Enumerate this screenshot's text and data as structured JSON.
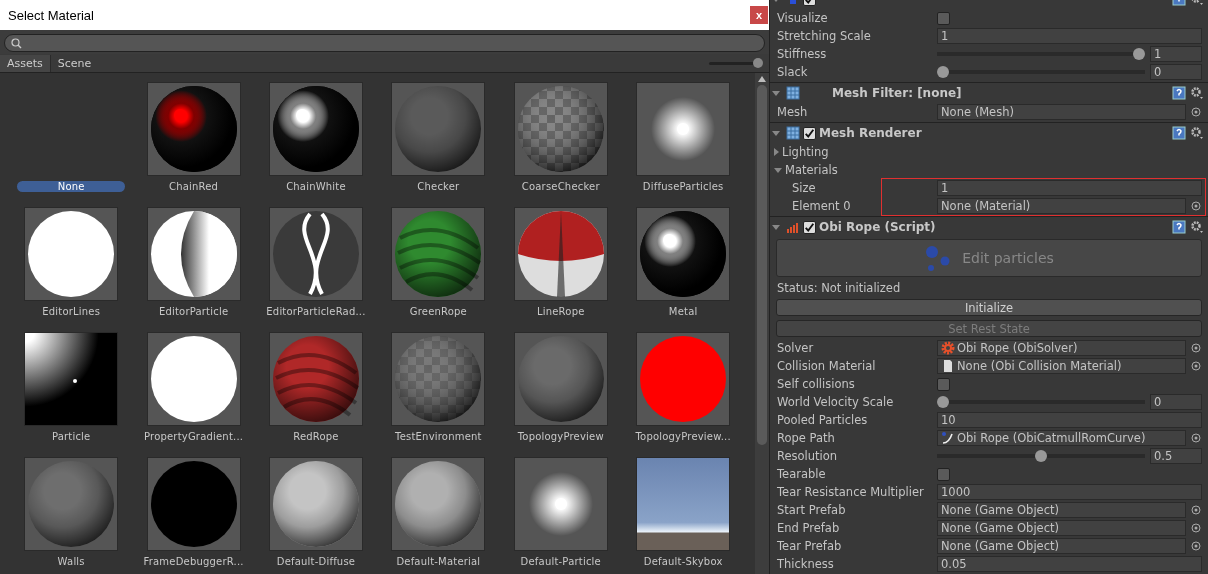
{
  "picker": {
    "title": "Select Material",
    "close_label": "x",
    "tabs": [
      {
        "label": "Assets",
        "selected": true
      },
      {
        "label": "Scene",
        "selected": false
      }
    ],
    "zoom": {
      "level": 1
    },
    "items": [
      {
        "name": "None",
        "kind": "none",
        "selected": true
      },
      {
        "name": "ChainRed",
        "kind": "shiny",
        "color": "#ff0000",
        "selected": false
      },
      {
        "name": "ChainWhite",
        "kind": "shiny",
        "color": "#ffffff",
        "selected": false
      },
      {
        "name": "Checker",
        "kind": "matte",
        "color": "#5a5a5a",
        "selected": false
      },
      {
        "name": "CoarseChecker",
        "kind": "checker",
        "color": "#666666",
        "selected": false
      },
      {
        "name": "DiffuseParticles",
        "kind": "glow",
        "color": "#ffffff",
        "selected": false
      },
      {
        "name": "EditorLines",
        "kind": "disc",
        "color": "#ffffff",
        "selected": false
      },
      {
        "name": "EditorParticle",
        "kind": "half",
        "color": "#ffffff",
        "selected": false
      },
      {
        "name": "EditorParticleRad...",
        "kind": "loop",
        "color": "#ffffff",
        "selected": false
      },
      {
        "name": "GreenRope",
        "kind": "striped",
        "color": "#2f8a2f",
        "selected": false
      },
      {
        "name": "LineRope",
        "kind": "split",
        "color": "#b02020",
        "selected": false
      },
      {
        "name": "Metal",
        "kind": "shiny",
        "color": "#ffffff",
        "selected": false
      },
      {
        "name": "Particle",
        "kind": "gradient",
        "color": "#ffffff",
        "selected": false
      },
      {
        "name": "PropertyGradient...",
        "kind": "disc",
        "color": "#ffffff",
        "selected": false
      },
      {
        "name": "RedRope",
        "kind": "striped",
        "color": "#b02828",
        "selected": false
      },
      {
        "name": "TestEnvironment",
        "kind": "checker",
        "color": "#555555",
        "selected": false
      },
      {
        "name": "TopologyPreview",
        "kind": "matte",
        "color": "#6a6a6a",
        "selected": false
      },
      {
        "name": "TopologyPreview...",
        "kind": "disc",
        "color": "#ff0000",
        "selected": false
      },
      {
        "name": "Walls",
        "kind": "matte",
        "color": "#6e6e6e",
        "selected": false
      },
      {
        "name": "FrameDebuggerR...",
        "kind": "disc",
        "color": "#000000",
        "selected": false
      },
      {
        "name": "Default-Diffuse",
        "kind": "matte",
        "color": "#c4c4c4",
        "selected": false
      },
      {
        "name": "Default-Material",
        "kind": "matte",
        "color": "#b0b0b0",
        "selected": false
      },
      {
        "name": "Default-Particle",
        "kind": "glow",
        "color": "#ffffff",
        "selected": false
      },
      {
        "name": "Default-Skybox",
        "kind": "skybox",
        "color": "#6a84b0",
        "selected": false
      }
    ]
  },
  "inspector": {
    "rows": [
      {
        "kind": "header",
        "checked": true
      },
      {
        "kind": "checkbox",
        "label": "Visualize",
        "checked": false
      },
      {
        "kind": "field",
        "label": "Stretching Scale",
        "value": "1"
      },
      {
        "kind": "slider",
        "label": "Stiffness",
        "level": 1,
        "value": "1"
      },
      {
        "kind": "slider",
        "label": "Slack",
        "level": 0,
        "value": "0"
      },
      {
        "kind": "header",
        "title": "Mesh Filter: [none]"
      },
      {
        "kind": "object",
        "label": "Mesh",
        "value": "None (Mesh)"
      },
      {
        "kind": "header",
        "title": "Mesh Renderer",
        "checked": true
      },
      {
        "kind": "foldout",
        "label": "Lighting",
        "expanded": false
      },
      {
        "kind": "foldout",
        "label": "Materials",
        "expanded": true,
        "highlighted": true,
        "children": [
          {
            "kind": "field",
            "label": "Size",
            "value": "1"
          },
          {
            "kind": "object",
            "label": "Element 0",
            "value": "None (Material)"
          }
        ]
      },
      {
        "kind": "header",
        "title": "Obi Rope (Script)",
        "checked": true
      },
      {
        "kind": "bigbutton",
        "label": "Edit particles"
      },
      {
        "kind": "text",
        "label": "Status: Not initialized"
      },
      {
        "kind": "button",
        "label": "Initialize",
        "disabled": false
      },
      {
        "kind": "button",
        "label": "Set Rest State",
        "disabled": true
      },
      {
        "kind": "object",
        "label": "Solver",
        "value": "Obi Rope (ObiSolver)"
      },
      {
        "kind": "object",
        "label": "Collision Material",
        "value": "None (Obi Collision Material)"
      },
      {
        "kind": "checkbox",
        "label": "Self collisions",
        "checked": false
      },
      {
        "kind": "slider",
        "label": "World Velocity Scale",
        "level": 0,
        "value": "0"
      },
      {
        "kind": "field",
        "label": "Pooled Particles",
        "value": "10"
      },
      {
        "kind": "object",
        "label": "Rope Path",
        "value": "Obi Rope (ObiCatmullRomCurve)"
      },
      {
        "kind": "slider",
        "label": "Resolution",
        "level": 0.5,
        "value": "0.5"
      },
      {
        "kind": "checkbox",
        "label": "Tearable",
        "checked": false
      },
      {
        "kind": "field",
        "label": "Tear Resistance Multiplier",
        "value": "1000"
      },
      {
        "kind": "object",
        "label": "Start Prefab",
        "value": "None (Game Object)"
      },
      {
        "kind": "object",
        "label": "End Prefab",
        "value": "None (Game Object)"
      },
      {
        "kind": "object",
        "label": "Tear Prefab",
        "value": "None (Game Object)"
      },
      {
        "kind": "field",
        "label": "Thickness",
        "value": "0.05"
      }
    ]
  }
}
